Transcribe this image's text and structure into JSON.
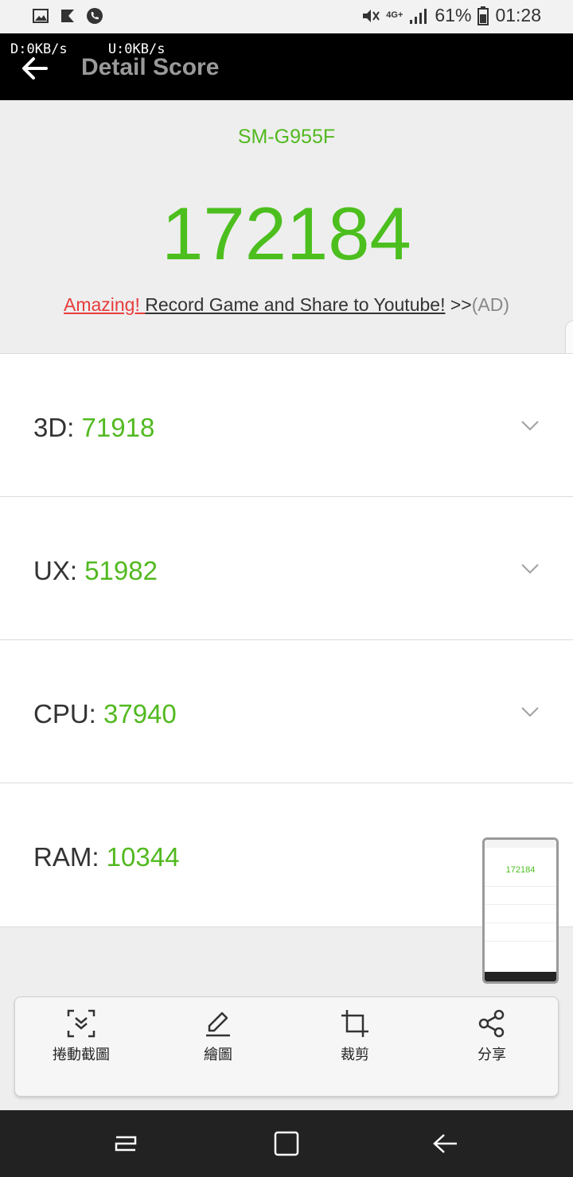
{
  "status_bar": {
    "battery": "61%",
    "time": "01:28",
    "network_label": "4G+"
  },
  "app_bar": {
    "net_speed": "D:0KB/s     U:0KB/s",
    "title": "Detail Score"
  },
  "header": {
    "device_model": "SM-G955F",
    "total_score": "172184",
    "ad_amazing": "Amazing! ",
    "ad_record": "Record Game and Share to Youtube!",
    "ad_arrows": " >>",
    "ad_tag": "(AD)"
  },
  "scores": [
    {
      "label": "3D: ",
      "value": "71918"
    },
    {
      "label": "UX: ",
      "value": "51982"
    },
    {
      "label": "CPU: ",
      "value": "37940"
    },
    {
      "label": "RAM: ",
      "value": "10344"
    }
  ],
  "screenshot_toolbar": {
    "scroll_capture": "捲動截圖",
    "draw": "繪圖",
    "crop": "裁剪",
    "share": "分享"
  },
  "thumbnail": {
    "score": "172184"
  },
  "colors": {
    "accent_green": "#52b920",
    "ad_red": "#e83c3c",
    "app_bar": "#000000"
  }
}
